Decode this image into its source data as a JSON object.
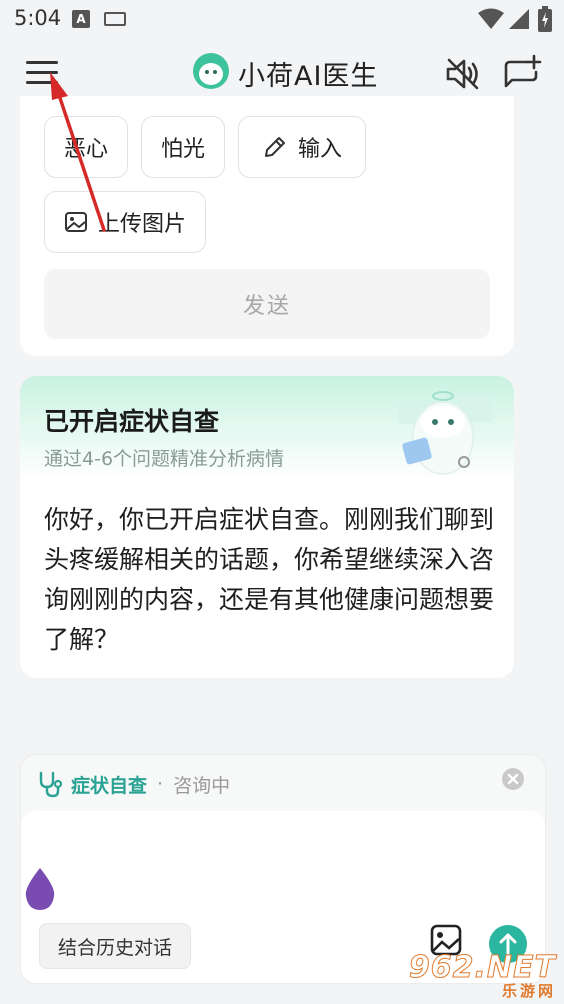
{
  "status_bar": {
    "time": "5:04",
    "app_icon_letter": "A"
  },
  "header": {
    "title": "小荷AI医生"
  },
  "quick_chips": [
    {
      "label": "恶心",
      "icon": ""
    },
    {
      "label": "怕光",
      "icon": ""
    },
    {
      "label": "输入",
      "icon": "pencil-icon"
    },
    {
      "label": "上传图片",
      "icon": "image-icon"
    }
  ],
  "send_button": {
    "label": "发送"
  },
  "symptom_card": {
    "title": "已开启症状自查",
    "subtitle": "通过4-6个问题精准分析病情",
    "message": "你好，你已开启症状自查。刚刚我们聊到头疼缓解相关的话题，你希望继续深入咨询刚刚的内容，还是有其他健康问题想要了解？"
  },
  "input_panel": {
    "tag": "症状自查",
    "separator": "·",
    "status": "咨询中",
    "history_button": "结合历史对话"
  },
  "watermark": {
    "main": "962.NET",
    "sub": "乐游网"
  },
  "colors": {
    "accent": "#2aa394",
    "submit": "#2bb6a0",
    "arrow": "#d62a2a",
    "drop": "#7a4bb0",
    "background": "#f3f4f6"
  }
}
